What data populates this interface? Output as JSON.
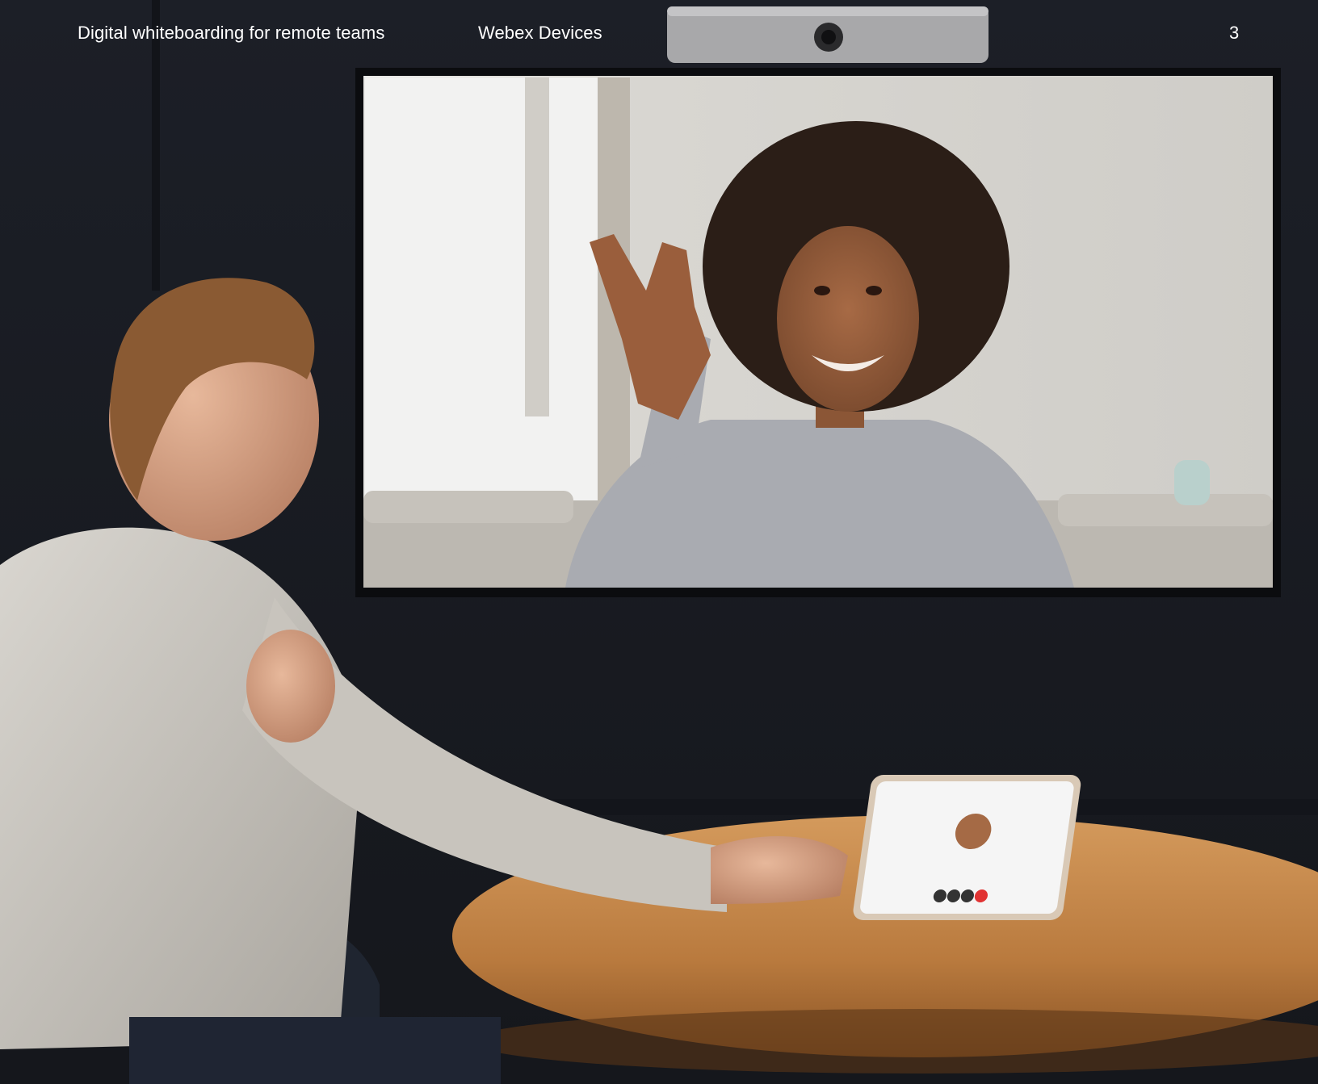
{
  "header": {
    "title": "Digital whiteboarding for remote teams",
    "section": "Webex Devices",
    "page_number": "3"
  },
  "scene": {
    "description_icon": "photo-illustration",
    "colors": {
      "wall": "#1d2028",
      "tv_bezel": "#0b0c0f",
      "call_background": "#d6d4d0",
      "table_wood": "#b8783c",
      "sweater": "#cfccc6",
      "camera_bar": "#a9a9ab"
    }
  }
}
